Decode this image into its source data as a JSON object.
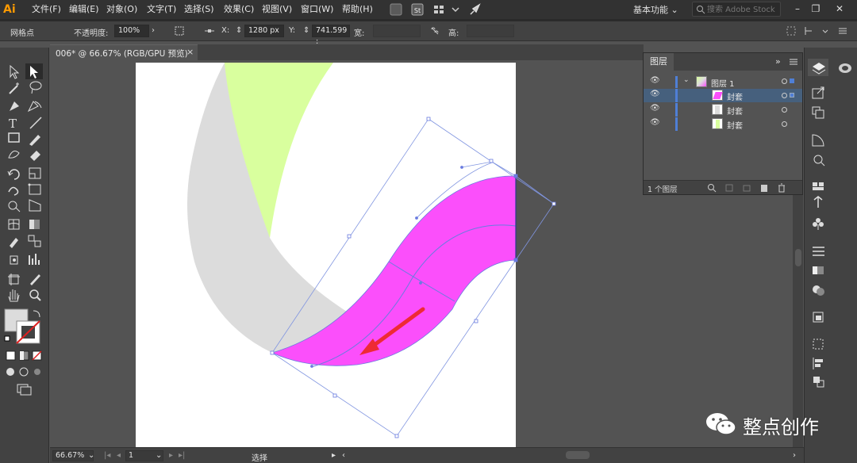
{
  "app": {
    "logo": "Ai",
    "menus": [
      "文件(F)",
      "编辑(E)",
      "对象(O)",
      "文字(T)",
      "选择(S)",
      "效果(C)",
      "视图(V)",
      "窗口(W)",
      "帮助(H)"
    ],
    "workspace": "基本功能",
    "stock_search_placeholder": "搜索 Adobe Stock"
  },
  "control_bar": {
    "selection_label": "网格点",
    "opacity_label": "不透明度:",
    "opacity_value": "100%",
    "x_label": "X:",
    "x_value": "1280 px",
    "y_label": "Y:",
    "y_value": "741.599 :",
    "width_label": "宽:",
    "height_label": "高:"
  },
  "document": {
    "tab_title": "006* @ 66.67% (RGB/GPU 预览)",
    "close_glyph": "×"
  },
  "status_bar": {
    "zoom": "66.67%",
    "artboard_number": "1",
    "tool_status": "选择"
  },
  "layers_panel": {
    "title": "图层",
    "rows": [
      {
        "name": "图层 1",
        "selected": false
      },
      {
        "name": "封套",
        "selected": true
      },
      {
        "name": "封套",
        "selected": false
      },
      {
        "name": "封套",
        "selected": false
      }
    ],
    "count_label": "1 个图层"
  },
  "watermark": {
    "text": "整点创作"
  },
  "colors": {
    "accent_selection": "#4f7fd6",
    "magenta_shape": "#fb4ffb",
    "lime_shape": "#d9ff9e",
    "grey_shape": "#dcdcdc",
    "arrow_red": "#ee2a35",
    "logo_orange": "#ff9a00"
  }
}
